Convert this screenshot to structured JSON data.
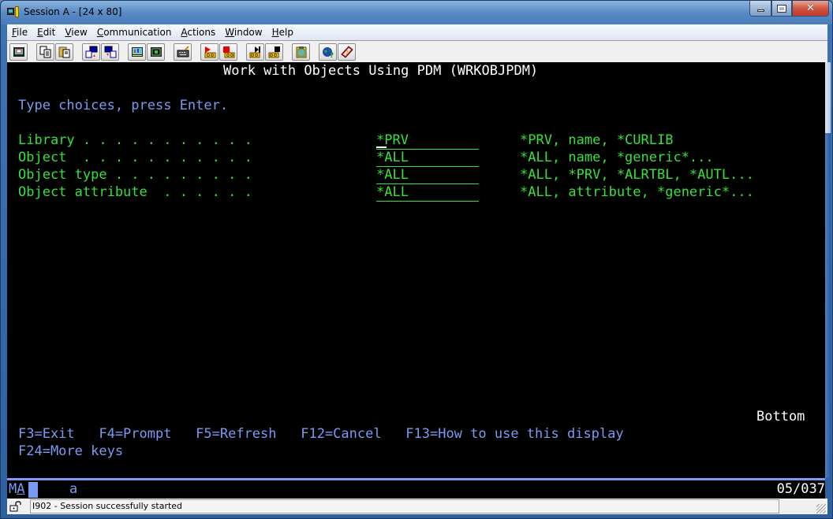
{
  "window": {
    "title": "Session A - [24 x 80]",
    "controls": {
      "minimize": "minimize",
      "maximize": "maximize",
      "close": "close"
    }
  },
  "menubar": {
    "items": [
      {
        "label": "File",
        "mnemonic": "F",
        "rest": "ile"
      },
      {
        "label": "Edit",
        "mnemonic": "E",
        "rest": "dit"
      },
      {
        "label": "View",
        "mnemonic": "V",
        "rest": "iew"
      },
      {
        "label": "Communication",
        "mnemonic": "C",
        "rest": "ommunication"
      },
      {
        "label": "Actions",
        "mnemonic": "A",
        "rest": "ctions"
      },
      {
        "label": "Window",
        "mnemonic": "W",
        "rest": "indow"
      },
      {
        "label": "Help",
        "mnemonic": "H",
        "rest": "elp"
      }
    ]
  },
  "toolbar": {
    "buttons": [
      "print-screen-icon",
      "copy-icon",
      "paste-icon",
      "send-file-icon",
      "receive-file-icon",
      "display-setup-icon",
      "color-map-icon",
      "keyboard-map-icon",
      "start-record-macro-icon",
      "stop-record-macro-icon",
      "play-macro-icon",
      "stop-macro-icon",
      "clipboard-icon",
      "web-help-icon",
      "help-book-icon"
    ]
  },
  "screen": {
    "title": "Work with Objects Using PDM (WRKOBJPDM)",
    "instruction": "Type choices, press Enter.",
    "fields": [
      {
        "label": "Library . . . . . . . . . . .",
        "value": "*PRV",
        "hint": "*PRV, name, *CURLIB"
      },
      {
        "label": "Object  . . . . . . . . . . .",
        "value": "*ALL",
        "hint": "*ALL, name, *generic*..."
      },
      {
        "label": "Object type . . . . . . . . .",
        "value": "*ALL",
        "hint": "*ALL, *PRV, *ALRTBL, *AUTL..."
      },
      {
        "label": "Object attribute  . . . . . .",
        "value": "*ALL",
        "hint": "*ALL, attribute, *generic*..."
      }
    ],
    "more_indicator": "Bottom",
    "function_keys_line1": "F3=Exit   F4=Prompt   F5=Refresh   F12=Cancel   F13=How to use this display",
    "function_keys_line2": "F24=More keys",
    "function_keys": [
      {
        "key": "F3",
        "label": "F3=Exit"
      },
      {
        "key": "F4",
        "label": "F4=Prompt"
      },
      {
        "key": "F5",
        "label": "F5=Refresh"
      },
      {
        "key": "F12",
        "label": "F12=Cancel"
      },
      {
        "key": "F13",
        "label": "F13=How to use this display"
      },
      {
        "key": "F24",
        "label": "F24=More keys"
      }
    ]
  },
  "oia": {
    "indicator_m": "M",
    "indicator_a": "A",
    "mode": "a",
    "cursor_position": "05/037"
  },
  "statusbar": {
    "message": "I902 - Session successfully started"
  },
  "colors": {
    "green": "#35e13a",
    "blue": "#7b9bf2",
    "white": "#ffffff",
    "background": "#000000"
  }
}
